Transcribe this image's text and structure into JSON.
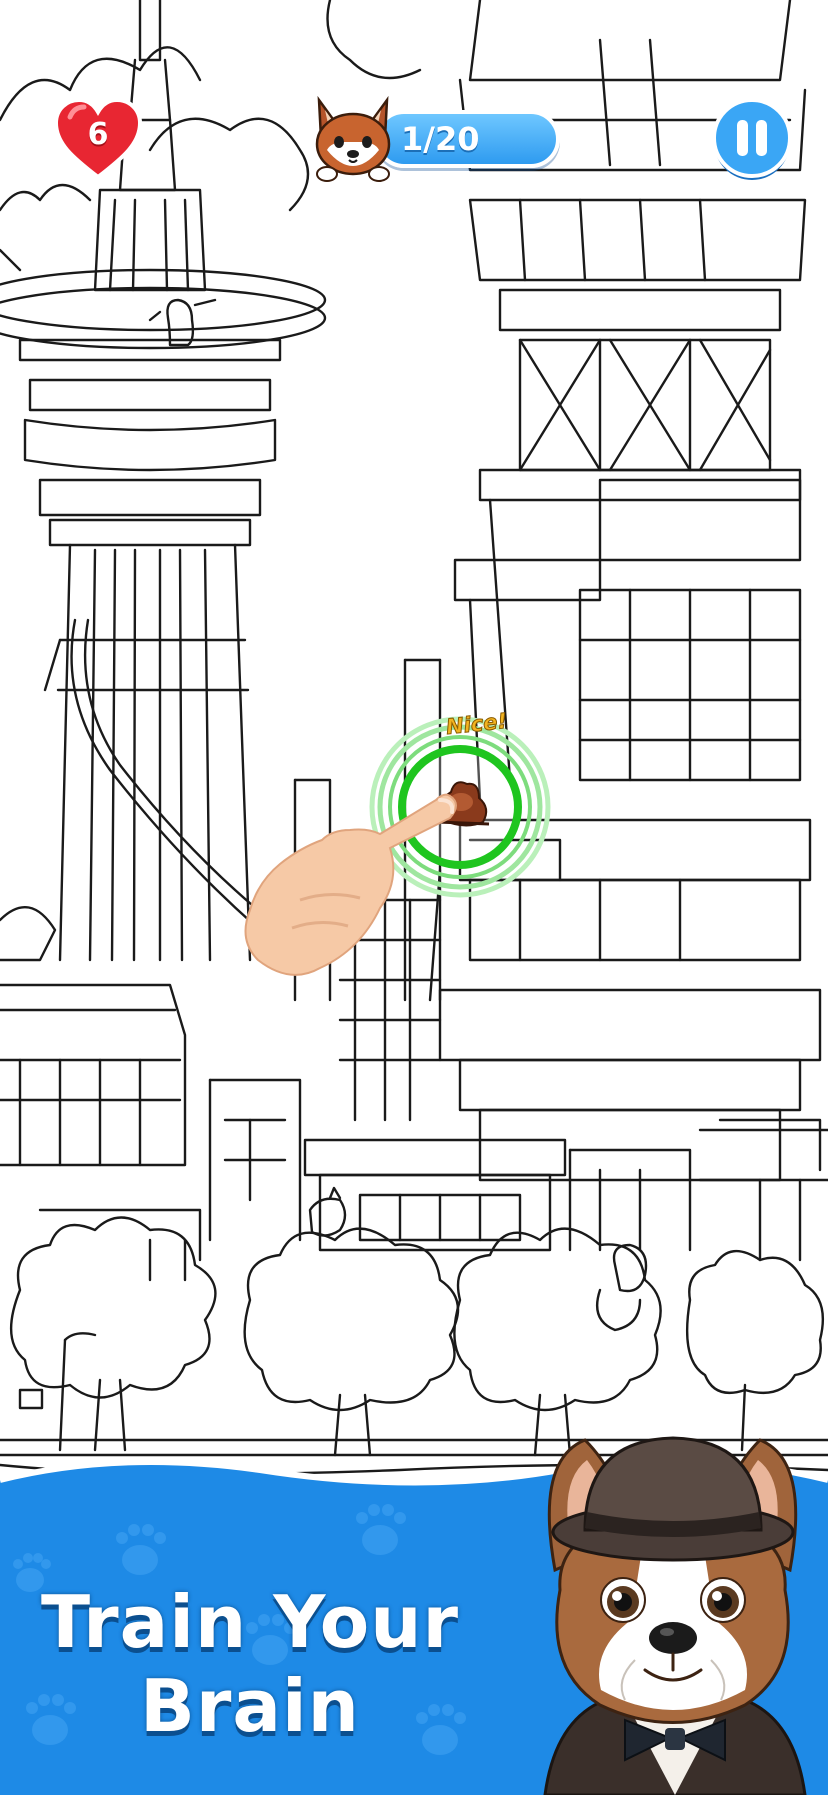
{
  "hud": {
    "lives": "6",
    "progress": "1/20",
    "pause_icon": "pause-icon",
    "lives_icon": "heart-icon",
    "avatar_icon": "shiba-dog-icon"
  },
  "hint": {
    "feedback": "Nice!",
    "pointer_icon": "hand-pointer-icon"
  },
  "banner": {
    "title_line1": "Train Your",
    "title_line2": "Brain",
    "mascot_icon": "french-bulldog-mascot"
  },
  "colors": {
    "heart": "#e82632",
    "hud_blue": "#2e9bf0",
    "target_ring": "#1fc51f",
    "banner_blue": "#1e8ae6",
    "feedback_text": "#f2b320"
  }
}
